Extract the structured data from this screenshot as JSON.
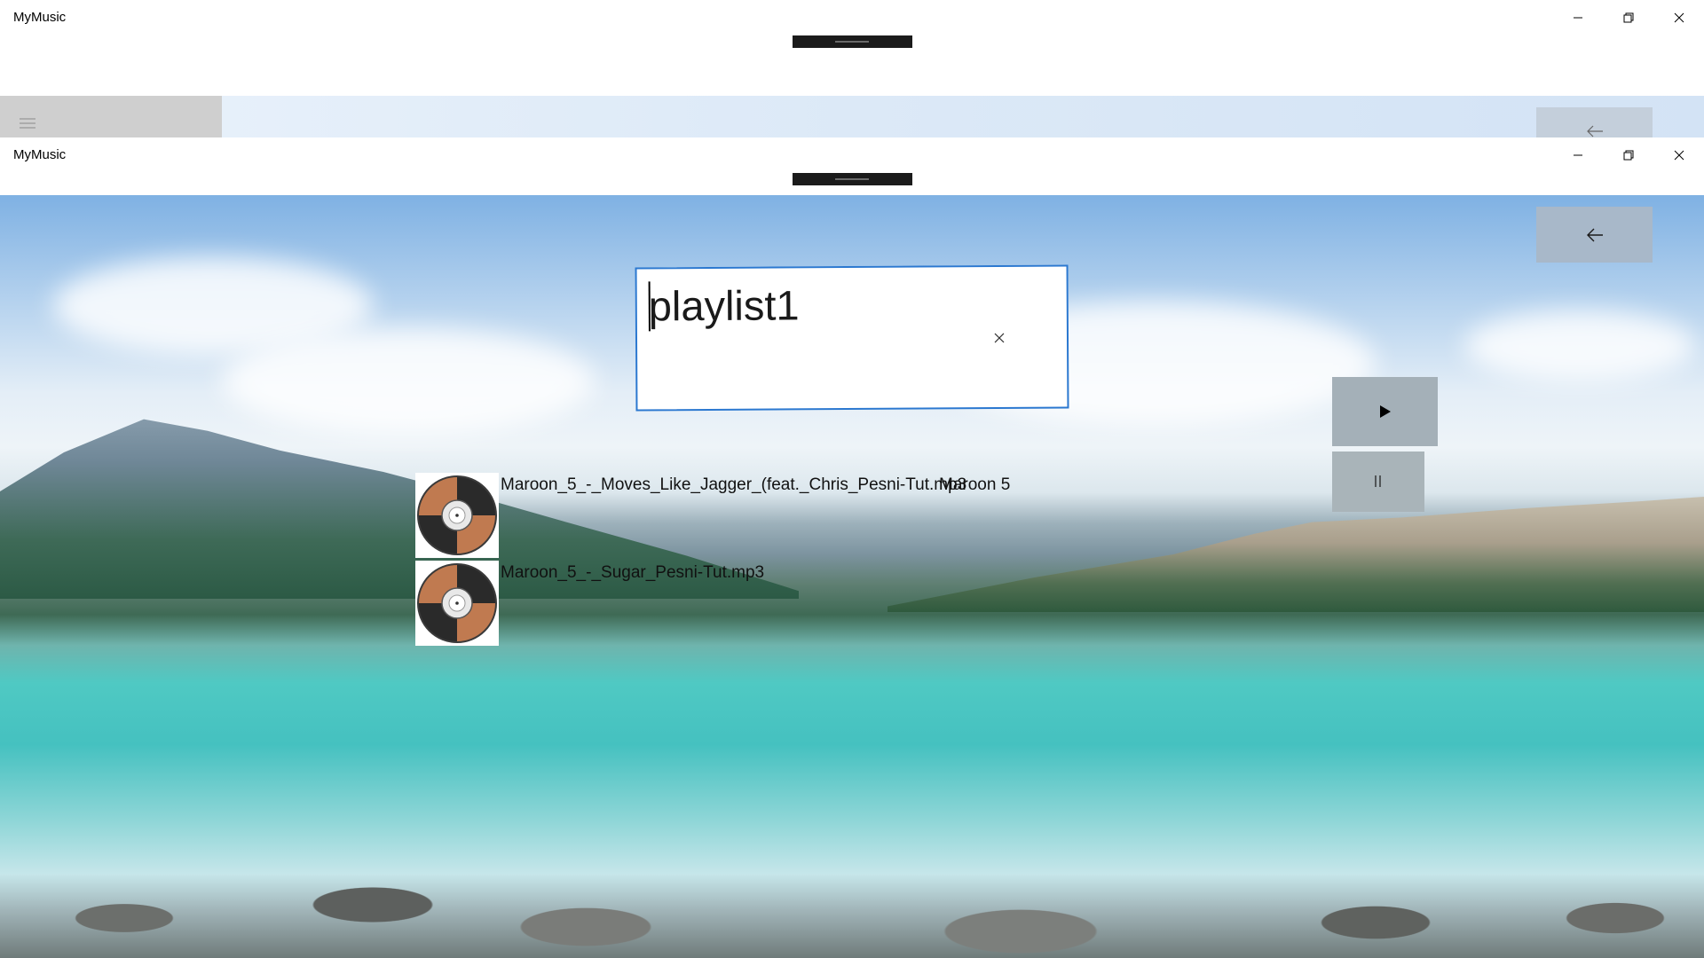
{
  "back_window": {
    "title": "MyMusic"
  },
  "front_window": {
    "title": "MyMusic"
  },
  "window_controls": {
    "minimize_icon": "minimize-icon",
    "maximize_icon": "restore-icon",
    "close_icon": "close-icon"
  },
  "search": {
    "value": "playlist1"
  },
  "player": {
    "play_icon": "play-icon",
    "pause_icon": "pause-icon"
  },
  "tracks": [
    {
      "title": "Maroon_5_-_Moves_Like_Jagger_(feat._Chris_Pesni-Tut.mp3",
      "artist": "Maroon 5",
      "icon": "vinyl-record-icon"
    },
    {
      "title": "Maroon_5_-_Sugar_Pesni-Tut.mp3",
      "artist": "",
      "icon": "vinyl-record-icon"
    }
  ],
  "colors": {
    "textbox_border": "#2b78d0",
    "button_bg": "#a8b8c9",
    "record_orange": "#c07a50"
  }
}
